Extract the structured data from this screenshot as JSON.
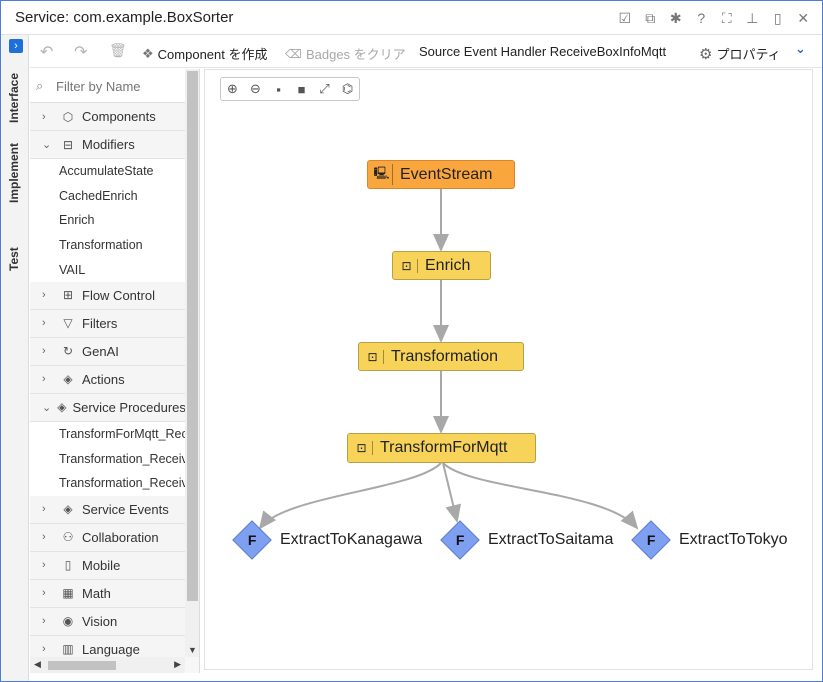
{
  "window": {
    "title": "Service: com.example.BoxSorter",
    "title_icons": [
      "check-square-icon",
      "split-icon",
      "bug-icon",
      "help-icon",
      "fullscreen-icon",
      "pin-icon",
      "popout-icon",
      "close-icon"
    ]
  },
  "vtabs": {
    "toggle": "›",
    "items": [
      "Interface",
      "Implement",
      "Test"
    ]
  },
  "toolbar": {
    "undo": "↶",
    "redo": "↷",
    "delete": "🗑",
    "create_component": "Component を作成",
    "clear_badges": "Badges をクリア",
    "context": "Source Event Handler ReceiveBoxInfoMqtt",
    "properties": "プロパティ",
    "collapse": "⌄"
  },
  "sidebar": {
    "filter_placeholder": "Filter by Name",
    "tree": [
      {
        "label": "Components",
        "icon": "cube-icon",
        "expanded": false
      },
      {
        "label": "Modifiers",
        "icon": "modifier-icon",
        "expanded": true,
        "children": [
          "AccumulateState",
          "CachedEnrich",
          "Enrich",
          "Transformation",
          "VAIL"
        ]
      },
      {
        "label": "Flow Control",
        "icon": "flow-icon",
        "expanded": false
      },
      {
        "label": "Filters",
        "icon": "filter-icon",
        "expanded": false
      },
      {
        "label": "GenAI",
        "icon": "genai-icon",
        "expanded": false
      },
      {
        "label": "Actions",
        "icon": "action-icon",
        "expanded": false
      },
      {
        "label": "Service Procedures",
        "icon": "procedure-icon",
        "expanded": true,
        "children": [
          "TransformForMqtt_Rec",
          "Transformation_Receiv",
          "Transformation_Receiv"
        ]
      },
      {
        "label": "Service Events",
        "icon": "event-icon",
        "expanded": false
      },
      {
        "label": "Collaboration",
        "icon": "people-icon",
        "expanded": false
      },
      {
        "label": "Mobile",
        "icon": "mobile-icon",
        "expanded": false
      },
      {
        "label": "Math",
        "icon": "calculator-icon",
        "expanded": false
      },
      {
        "label": "Vision",
        "icon": "eye-icon",
        "expanded": false
      },
      {
        "label": "Language",
        "icon": "book-icon",
        "expanded": false
      }
    ]
  },
  "canvas": {
    "zoom_tools": [
      "zoom-in-icon",
      "zoom-out-icon",
      "fit-selection-icon",
      "fit-icon",
      "expand-icon",
      "layout-icon"
    ],
    "nodes": {
      "event_stream": "EventStream",
      "enrich": "Enrich",
      "transformation": "Transformation",
      "transform_for_mqtt": "TransformForMqtt",
      "extract_kanagawa": "ExtractToKanagawa",
      "extract_saitama": "ExtractToSaitama",
      "extract_tokyo": "ExtractToTokyo"
    },
    "procedure_badge": "F"
  }
}
